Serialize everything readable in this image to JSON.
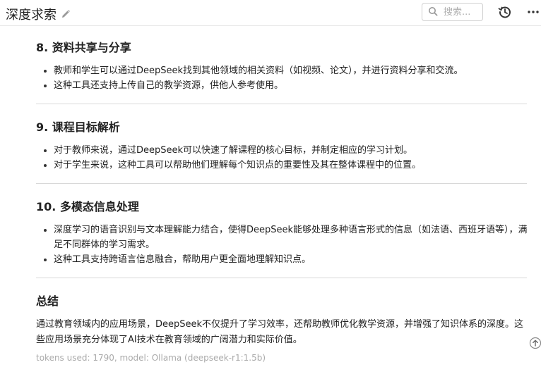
{
  "header": {
    "title": "深度求索",
    "search_placeholder": "搜索..."
  },
  "icons": {
    "edit": "pencil-icon",
    "search": "search-icon",
    "history": "history-icon",
    "more": "more-icon",
    "scroll_up": "arrow-up-circle-icon"
  },
  "sections": [
    {
      "heading": "8. 资料共享与分享",
      "items": [
        "教师和学生可以通过DeepSeek找到其他领域的相关资料（如视频、论文），并进行资料分享和交流。",
        "这种工具还支持上传自己的教学资源，供他人参考使用。"
      ]
    },
    {
      "heading": "9. 课程目标解析",
      "items": [
        "对于教师来说，通过DeepSeek可以快速了解课程的核心目标，并制定相应的学习计划。",
        "对于学生来说，这种工具可以帮助他们理解每个知识点的重要性及其在整体课程中的位置。"
      ]
    },
    {
      "heading": "10. 多模态信息处理",
      "items": [
        "深度学习的语音识别与文本理解能力结合，使得DeepSeek能够处理多种语言形式的信息（如法语、西班牙语等），满足不同群体的学习需求。",
        "这种工具支持跨语言信息融合，帮助用户更全面地理解知识点。"
      ]
    }
  ],
  "summary": {
    "heading": "总结",
    "text": "通过教育领域内的应用场景，DeepSeek不仅提升了学习效率，还帮助教师优化教学资源，并增强了知识体系的深度。这些应用场景充分体现了AI技术在教育领域的广阔潜力和实际价值。"
  },
  "footer": {
    "tokens": "tokens used: 1790, model: Ollama (deepseek-r1:1.5b)"
  }
}
